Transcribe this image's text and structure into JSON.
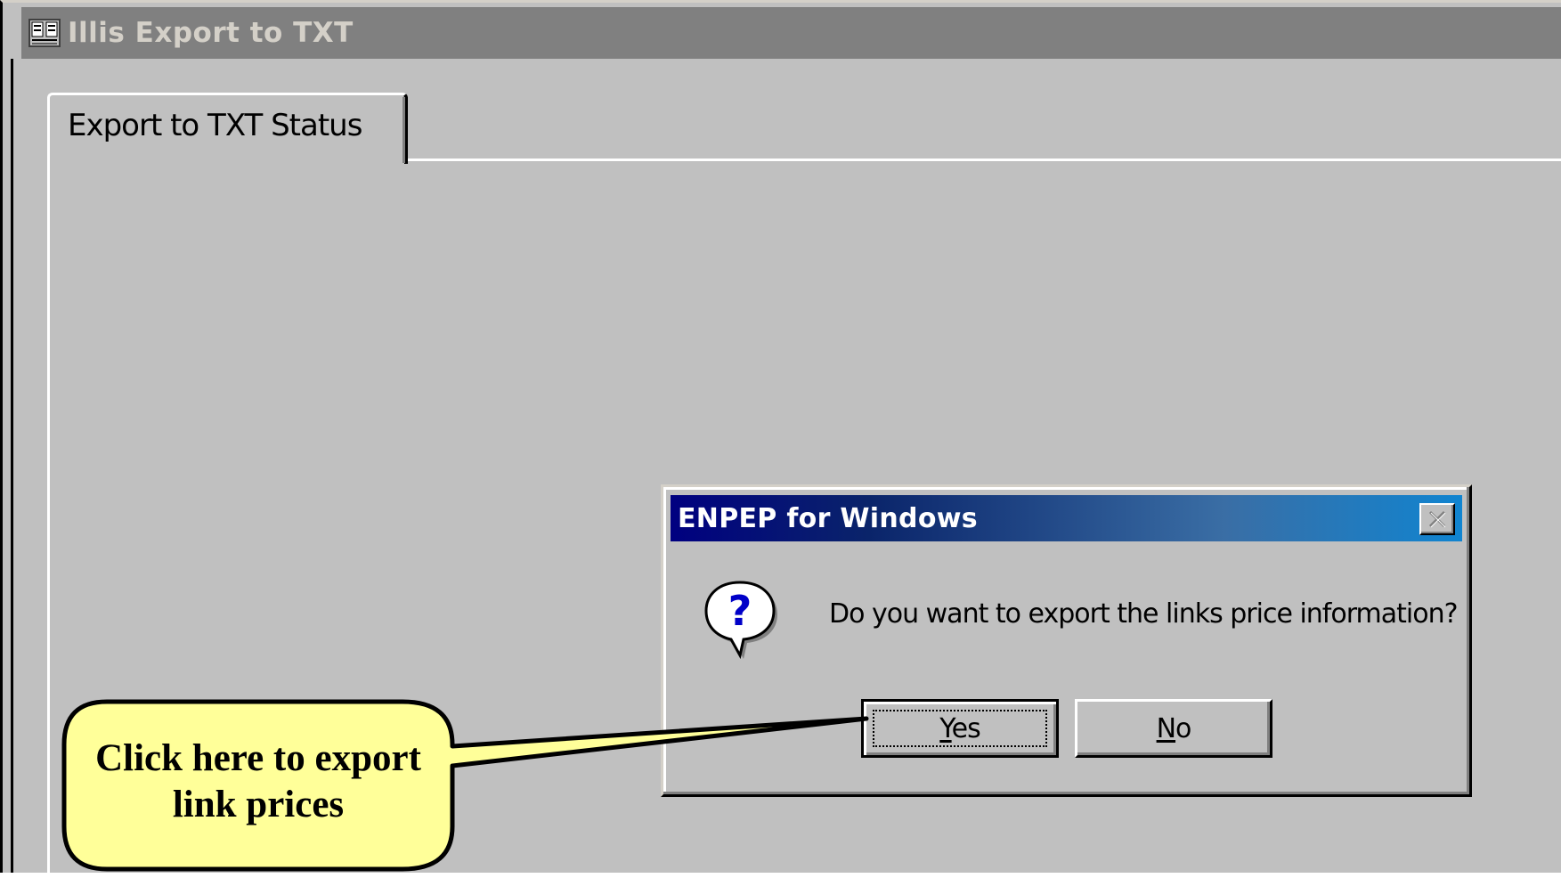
{
  "window": {
    "title": "Illis Export to TXT",
    "icon": "app-icon"
  },
  "tabs": [
    {
      "label": "Export to TXT Status",
      "selected": true
    }
  ],
  "dialog": {
    "title": "ENPEP for Windows",
    "icon": "question-icon",
    "message": "Do you want to export the links price information?",
    "buttons": {
      "yes_label": "Yes",
      "yes_mnemonic": "Y",
      "yes_rest": "es",
      "no_label": "No",
      "no_mnemonic": "N",
      "no_rest": "o"
    },
    "close_icon": "close-icon"
  },
  "callout": {
    "line1": "Click here to export",
    "line2": "link prices",
    "fill_color": "#ffff99"
  },
  "colors": {
    "window_bg": "#c0c0c0",
    "inactive_titlebar": "#808080",
    "active_titlebar_start": "#000080",
    "active_titlebar_end": "#1084d0"
  }
}
